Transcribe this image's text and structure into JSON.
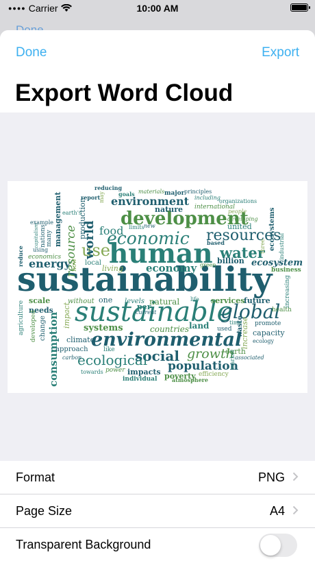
{
  "status": {
    "carrier": "Carrier",
    "time": "10:00 AM"
  },
  "background_toolbar": {
    "done": "Done"
  },
  "nav": {
    "done_label": "Done",
    "export_label": "Export",
    "title": "Export Word Cloud"
  },
  "settings": {
    "format": {
      "label": "Format",
      "value": "PNG"
    },
    "page_size": {
      "label": "Page Size",
      "value": "A4"
    },
    "transparent_background": {
      "label": "Transparent Background",
      "enabled": false
    }
  },
  "word_cloud": {
    "colors": {
      "dark": "#1f5e6e",
      "teal": "#2a7f77",
      "green": "#4d8f46",
      "light_green": "#86a955"
    },
    "words": [
      "sustainability",
      "sustainable",
      "human",
      "environmental",
      "global",
      "development",
      "economic",
      "resources",
      "water",
      "use",
      "energy",
      "social",
      "ecological",
      "population",
      "growth",
      "consumption",
      "resource",
      "world",
      "environment",
      "economy",
      "systems",
      "countries",
      "natural",
      "impacts",
      "poverty",
      "food",
      "management",
      "production",
      "ecosystem",
      "ecosystems",
      "scale",
      "needs",
      "climate",
      "approach",
      "change",
      "agriculture",
      "developed",
      "impact",
      "without",
      "one",
      "levels",
      "life",
      "services",
      "future",
      "health",
      "increasing",
      "promote",
      "capacity",
      "ecology",
      "waste",
      "increase",
      "earth",
      "market",
      "associated",
      "efficiency",
      "atmosphere",
      "individual",
      "power",
      "towards",
      "carbon",
      "like",
      "per",
      "land",
      "current",
      "used",
      "time",
      "business",
      "billion",
      "industrial",
      "three",
      "united",
      "people",
      "developing",
      "organizations",
      "including",
      "international",
      "principles",
      "major",
      "materials",
      "goals",
      "reducing",
      "report",
      "may",
      "earth's",
      "nature",
      "new",
      "limits",
      "based",
      "green",
      "living",
      "local",
      "now",
      "many",
      "nations",
      "using",
      "capitalism",
      "example",
      "economics",
      "reduce"
    ]
  }
}
